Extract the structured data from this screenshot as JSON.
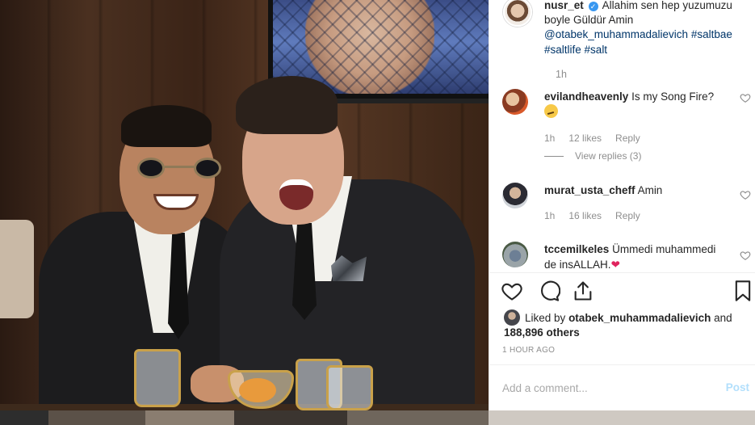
{
  "post": {
    "owner_username": "nusr_et",
    "verified_symbol": "✓",
    "caption_text": "Allahim sen hep yuzumuzu boyle Güldür Amin",
    "caption_mention": "@otabek_muhammadalievich",
    "caption_tags": [
      "#saltbae",
      "#saltlife",
      "#salt"
    ],
    "caption_time": "1h"
  },
  "comments": [
    {
      "username": "evilandheavenly",
      "text": "Is my Song Fire?",
      "emoji": "thinking-face",
      "time": "1h",
      "likes": "12 likes",
      "reply_label": "Reply",
      "view_replies": "View replies (3)"
    },
    {
      "username": "murat_usta_cheff",
      "text": "Amin",
      "time": "1h",
      "likes": "16 likes",
      "reply_label": "Reply"
    },
    {
      "username": "tccemilkeles",
      "text": "Ümmedi muhammedi de insALLAH.",
      "emoji": "red-heart"
    }
  ],
  "likes": {
    "prefix": "Liked by",
    "user": "otabek_muhammadalievich",
    "joiner": "and",
    "others": "188,896 others"
  },
  "post_time": "1 HOUR AGO",
  "add_comment": {
    "placeholder": "Add a comment...",
    "post_label": "Post"
  },
  "icons": {
    "like": "heart-icon",
    "comment": "comment-bubble-icon",
    "share": "share-icon",
    "save": "bookmark-icon"
  },
  "colors": {
    "link": "#003569",
    "verified": "#3897f0",
    "muted": "#8e8e8e",
    "post_button": "#b2dffc"
  }
}
